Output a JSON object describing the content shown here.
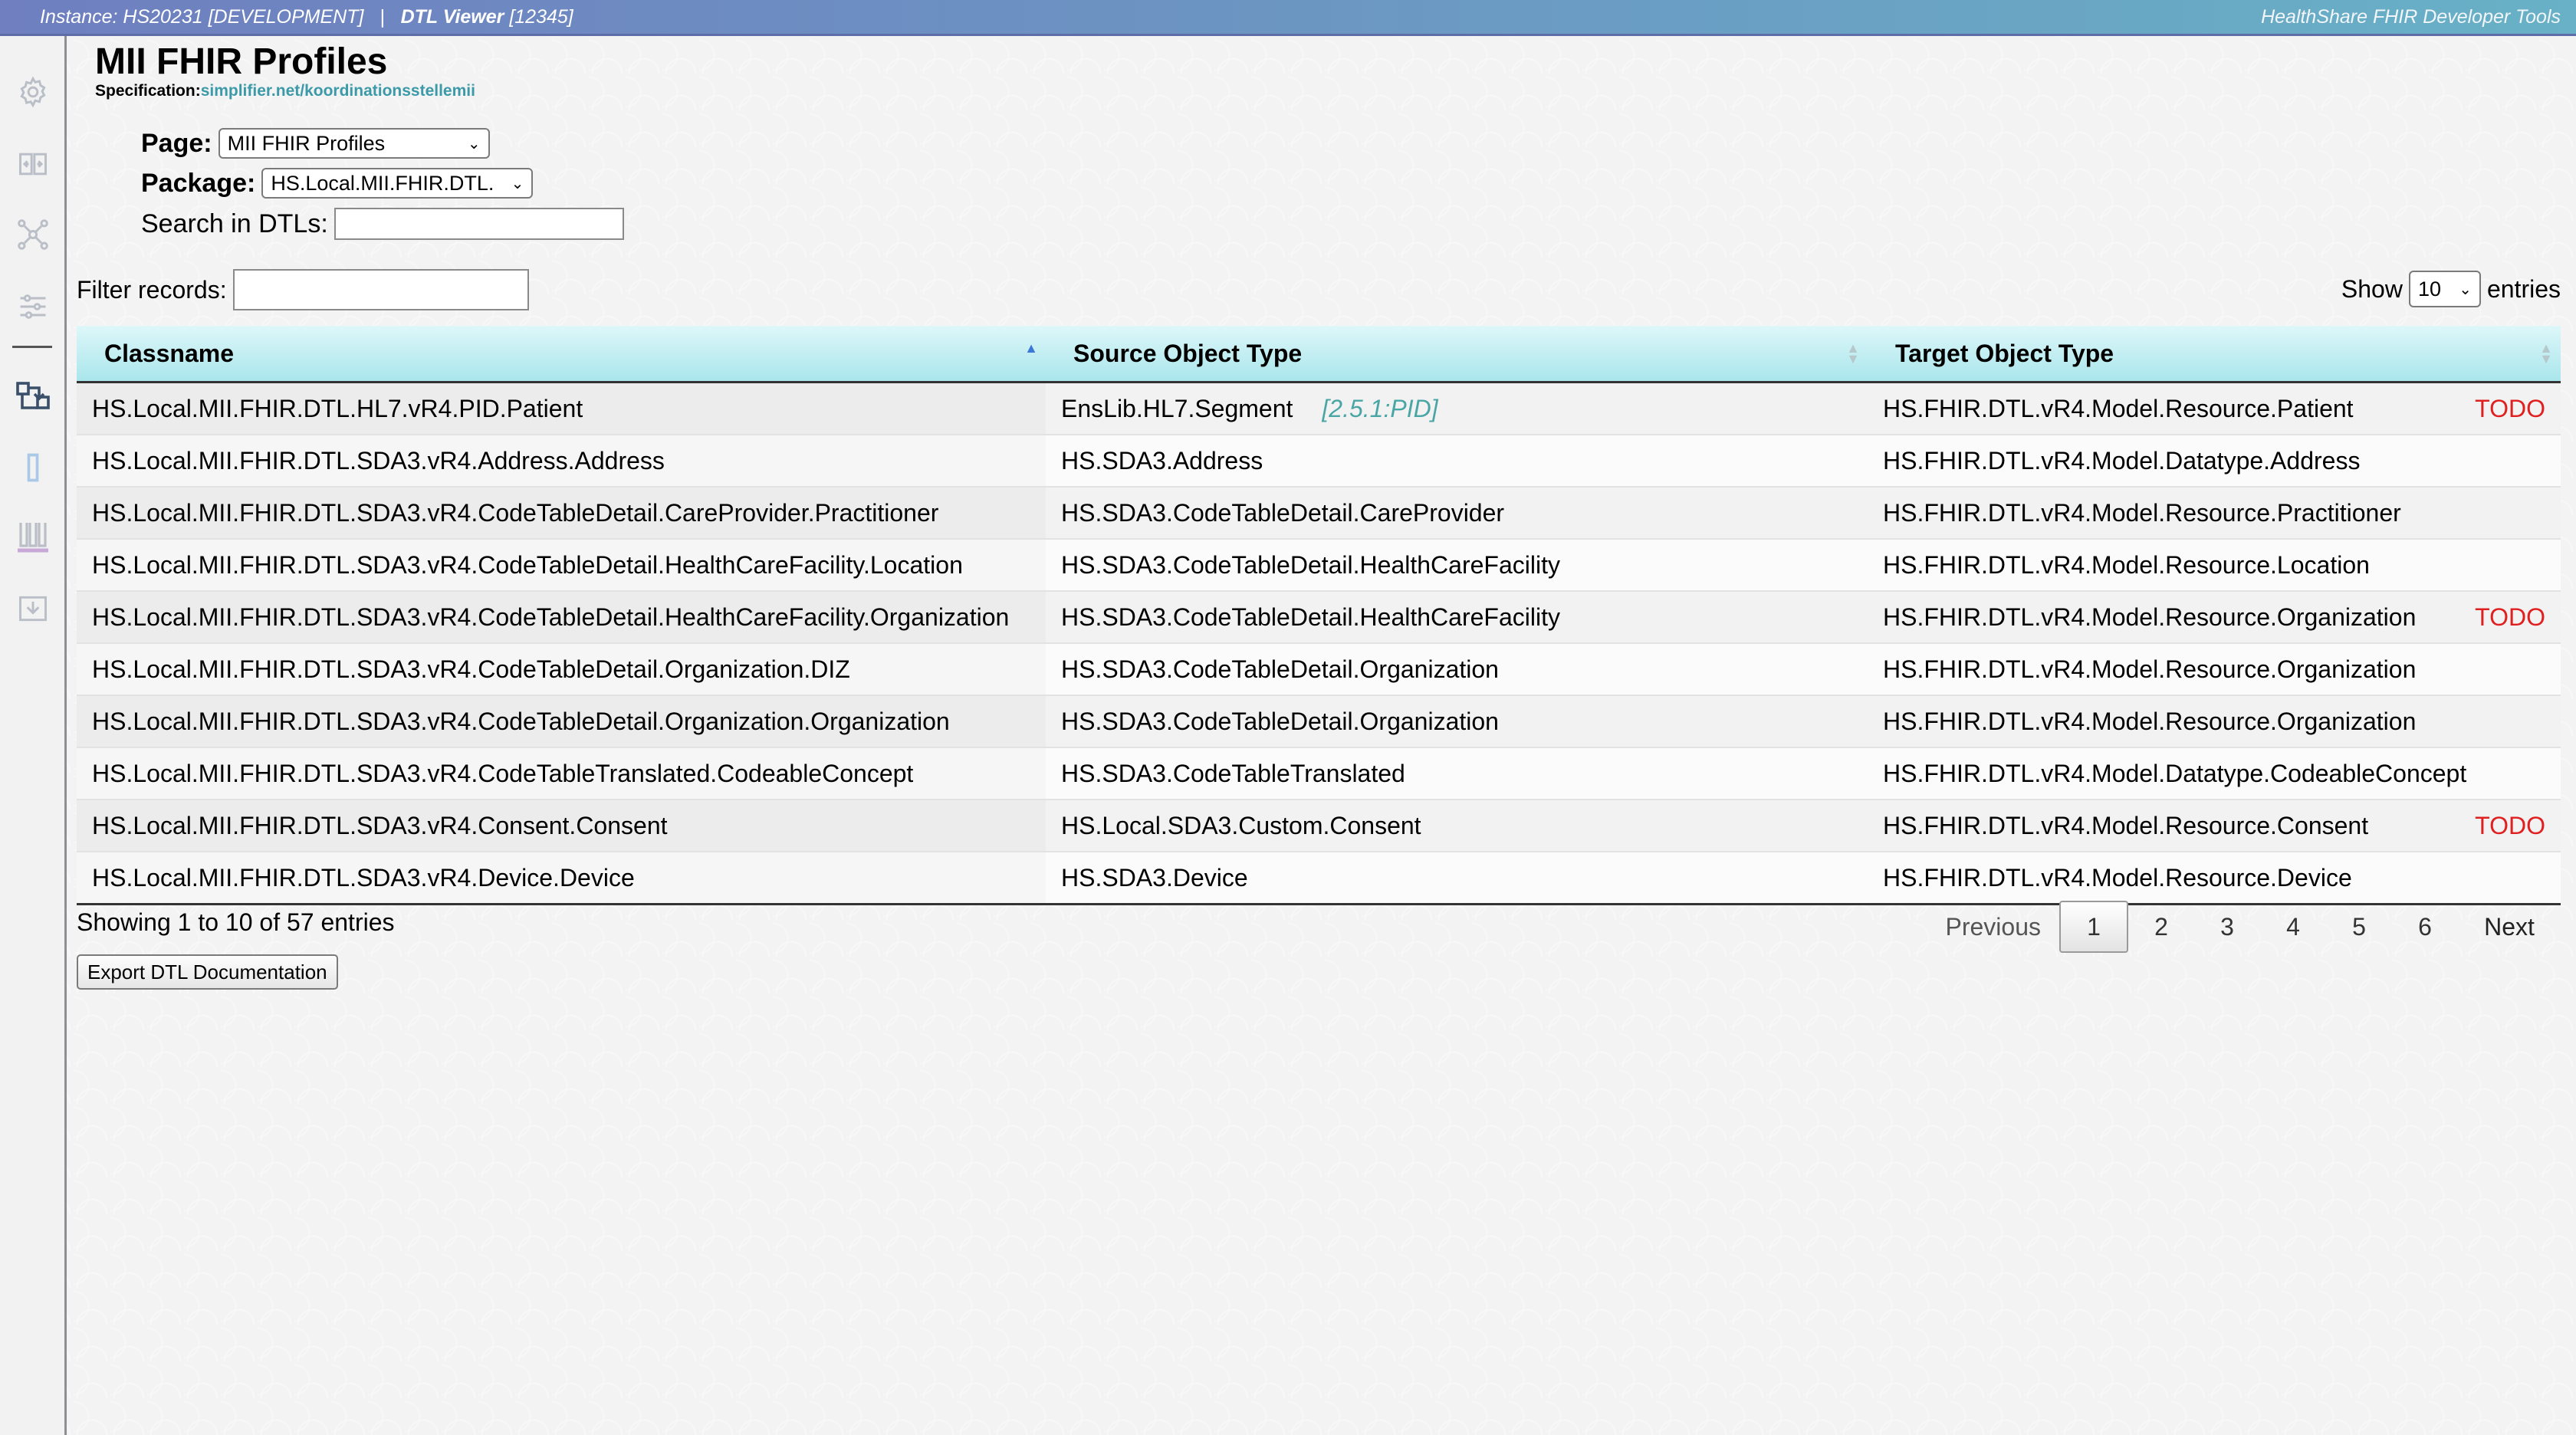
{
  "topbar": {
    "instance": "Instance: HS20231 [DEVELOPMENT]",
    "separator": "|",
    "viewer_name": "DTL Viewer",
    "viewer_id": "[12345]",
    "product": "HealthShare FHIR Developer Tools"
  },
  "sidebar": {
    "icons": [
      "gear-icon",
      "compare-icon",
      "network-icon",
      "settings-sliders-icon",
      "transform-icon",
      "document-icon",
      "lab-icon",
      "import-icon"
    ]
  },
  "page": {
    "title": "MII FHIR Profiles",
    "spec_label": "Specification:",
    "spec_link": "simplifier.net/koordinationsstellemii"
  },
  "form": {
    "page_label": "Page:",
    "page_value": "MII FHIR Profiles",
    "package_label": "Package:",
    "package_value": "HS.Local.MII.FHIR.DTL.",
    "search_label": "Search in DTLs:",
    "search_value": ""
  },
  "table_controls": {
    "filter_label": "Filter records:",
    "filter_value": "",
    "show_label": "Show",
    "show_value": "10",
    "entries_label": "entries"
  },
  "table": {
    "columns": [
      "Classname",
      "Source Object Type",
      "Target Object Type"
    ],
    "rows": [
      {
        "classname": "HS.Local.MII.FHIR.DTL.HL7.vR4.PID.Patient",
        "source": "EnsLib.HL7.Segment",
        "source_note": "[2.5.1:PID]",
        "target": "HS.FHIR.DTL.vR4.Model.Resource.Patient",
        "flag": "TODO"
      },
      {
        "classname": "HS.Local.MII.FHIR.DTL.SDA3.vR4.Address.Address",
        "source": "HS.SDA3.Address",
        "source_note": "",
        "target": "HS.FHIR.DTL.vR4.Model.Datatype.Address",
        "flag": ""
      },
      {
        "classname": "HS.Local.MII.FHIR.DTL.SDA3.vR4.CodeTableDetail.CareProvider.Practitioner",
        "source": "HS.SDA3.CodeTableDetail.CareProvider",
        "source_note": "",
        "target": "HS.FHIR.DTL.vR4.Model.Resource.Practitioner",
        "flag": ""
      },
      {
        "classname": "HS.Local.MII.FHIR.DTL.SDA3.vR4.CodeTableDetail.HealthCareFacility.Location",
        "source": "HS.SDA3.CodeTableDetail.HealthCareFacility",
        "source_note": "",
        "target": "HS.FHIR.DTL.vR4.Model.Resource.Location",
        "flag": ""
      },
      {
        "classname": "HS.Local.MII.FHIR.DTL.SDA3.vR4.CodeTableDetail.HealthCareFacility.Organization",
        "source": "HS.SDA3.CodeTableDetail.HealthCareFacility",
        "source_note": "",
        "target": "HS.FHIR.DTL.vR4.Model.Resource.Organization",
        "flag": "TODO"
      },
      {
        "classname": "HS.Local.MII.FHIR.DTL.SDA3.vR4.CodeTableDetail.Organization.DIZ",
        "source": "HS.SDA3.CodeTableDetail.Organization",
        "source_note": "",
        "target": "HS.FHIR.DTL.vR4.Model.Resource.Organization",
        "flag": ""
      },
      {
        "classname": "HS.Local.MII.FHIR.DTL.SDA3.vR4.CodeTableDetail.Organization.Organization",
        "source": "HS.SDA3.CodeTableDetail.Organization",
        "source_note": "",
        "target": "HS.FHIR.DTL.vR4.Model.Resource.Organization",
        "flag": ""
      },
      {
        "classname": "HS.Local.MII.FHIR.DTL.SDA3.vR4.CodeTableTranslated.CodeableConcept",
        "source": "HS.SDA3.CodeTableTranslated",
        "source_note": "",
        "target": "HS.FHIR.DTL.vR4.Model.Datatype.CodeableConcept",
        "flag": ""
      },
      {
        "classname": "HS.Local.MII.FHIR.DTL.SDA3.vR4.Consent.Consent",
        "source": "HS.Local.SDA3.Custom.Consent",
        "source_note": "",
        "target": "HS.FHIR.DTL.vR4.Model.Resource.Consent",
        "flag": "TODO"
      },
      {
        "classname": "HS.Local.MII.FHIR.DTL.SDA3.vR4.Device.Device",
        "source": "HS.SDA3.Device",
        "source_note": "",
        "target": "HS.FHIR.DTL.vR4.Model.Resource.Device",
        "flag": ""
      }
    ]
  },
  "footer": {
    "info": "Showing 1 to 10 of 57 entries",
    "previous": "Previous",
    "pages": [
      "1",
      "2",
      "3",
      "4",
      "5",
      "6"
    ],
    "current_page": "1",
    "next": "Next",
    "export_button": "Export DTL Documentation"
  }
}
